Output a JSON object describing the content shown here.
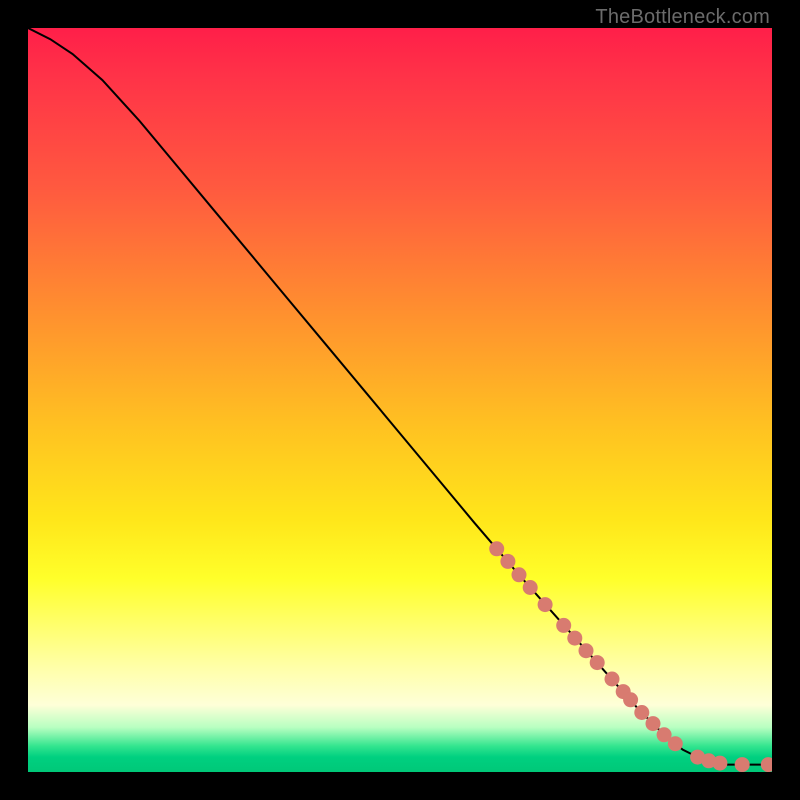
{
  "attribution": "TheBottleneck.com",
  "chart_data": {
    "type": "line",
    "title": "",
    "xlabel": "",
    "ylabel": "",
    "xlim": [
      0,
      100
    ],
    "ylim": [
      0,
      100
    ],
    "grid": false,
    "series": [
      {
        "name": "curve",
        "x": [
          0,
          3,
          6,
          10,
          15,
          20,
          25,
          30,
          35,
          40,
          45,
          50,
          55,
          60,
          63,
          66,
          70,
          74,
          78,
          82,
          85,
          88,
          90,
          92,
          94,
          96,
          98,
          100
        ],
        "y": [
          100,
          98.5,
          96.5,
          93,
          87.5,
          81.5,
          75.5,
          69.5,
          63.5,
          57.5,
          51.5,
          45.5,
          39.5,
          33.5,
          30,
          26.5,
          22,
          17.5,
          13,
          8.5,
          5.5,
          3,
          2,
          1.4,
          1,
          1,
          1,
          1
        ]
      }
    ],
    "points": {
      "name": "highlighted-range",
      "x": [
        63,
        64.5,
        66,
        67.5,
        69.5,
        72,
        73.5,
        75,
        76.5,
        78.5,
        80,
        81,
        82.5,
        84,
        85.5,
        87,
        90,
        91.5,
        93,
        96,
        99.5
      ],
      "y": [
        30,
        28.3,
        26.5,
        24.8,
        22.5,
        19.7,
        18,
        16.3,
        14.7,
        12.5,
        10.8,
        9.7,
        8,
        6.5,
        5,
        3.8,
        2,
        1.5,
        1.2,
        1,
        1
      ]
    }
  }
}
